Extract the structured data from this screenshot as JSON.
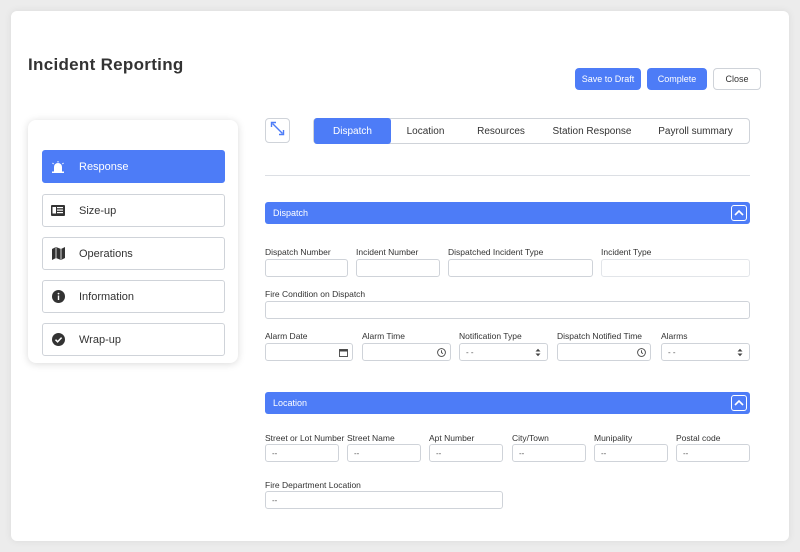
{
  "header": {
    "title": "Incident Reporting",
    "save_draft_label": "Save to Draft",
    "complete_label": "Complete",
    "close_label": "Close"
  },
  "sidebar": {
    "items": [
      {
        "label": "Response",
        "icon": "siren-icon",
        "active": true
      },
      {
        "label": "Size-up",
        "icon": "map-icon",
        "active": false
      },
      {
        "label": "Operations",
        "icon": "folded-map-icon",
        "active": false
      },
      {
        "label": "Information",
        "icon": "info-icon",
        "active": false
      },
      {
        "label": "Wrap-up",
        "icon": "check-circle-icon",
        "active": false
      }
    ]
  },
  "tabs": [
    {
      "label": "Dispatch",
      "active": true
    },
    {
      "label": "Location",
      "active": false
    },
    {
      "label": "Resources",
      "active": false
    },
    {
      "label": "Station Response",
      "active": false
    },
    {
      "label": "Payroll summary",
      "active": false
    }
  ],
  "dispatch": {
    "title": "Dispatch",
    "dispatch_number_label": "Dispatch Number",
    "incident_number_label": "Incident Number",
    "dispatched_incident_type_label": "Dispatched Incident Type",
    "incident_type_label": "Incident Type",
    "fire_condition_label": "Fire Condition on Dispatch",
    "alarm_date_label": "Alarm Date",
    "alarm_time_label": "Alarm Time",
    "notification_type_label": "Notification Type",
    "notification_type_value": "- -",
    "dispatch_notified_time_label": "Dispatch Notified Time",
    "alarms_label": "Alarms",
    "alarms_value": "- -"
  },
  "location": {
    "title": "Location",
    "street_lot_label": "Street or Lot Number",
    "street_name_label": "Street Name",
    "apt_number_label": "Apt Number",
    "city_label": "City/Town",
    "munipality_label": "Munipality",
    "postal_label": "Postal code",
    "fire_dept_label": "Fire Department Location",
    "placeholder": "--"
  },
  "colors": {
    "accent": "#4d7cf7",
    "border": "#cfd3d9"
  }
}
